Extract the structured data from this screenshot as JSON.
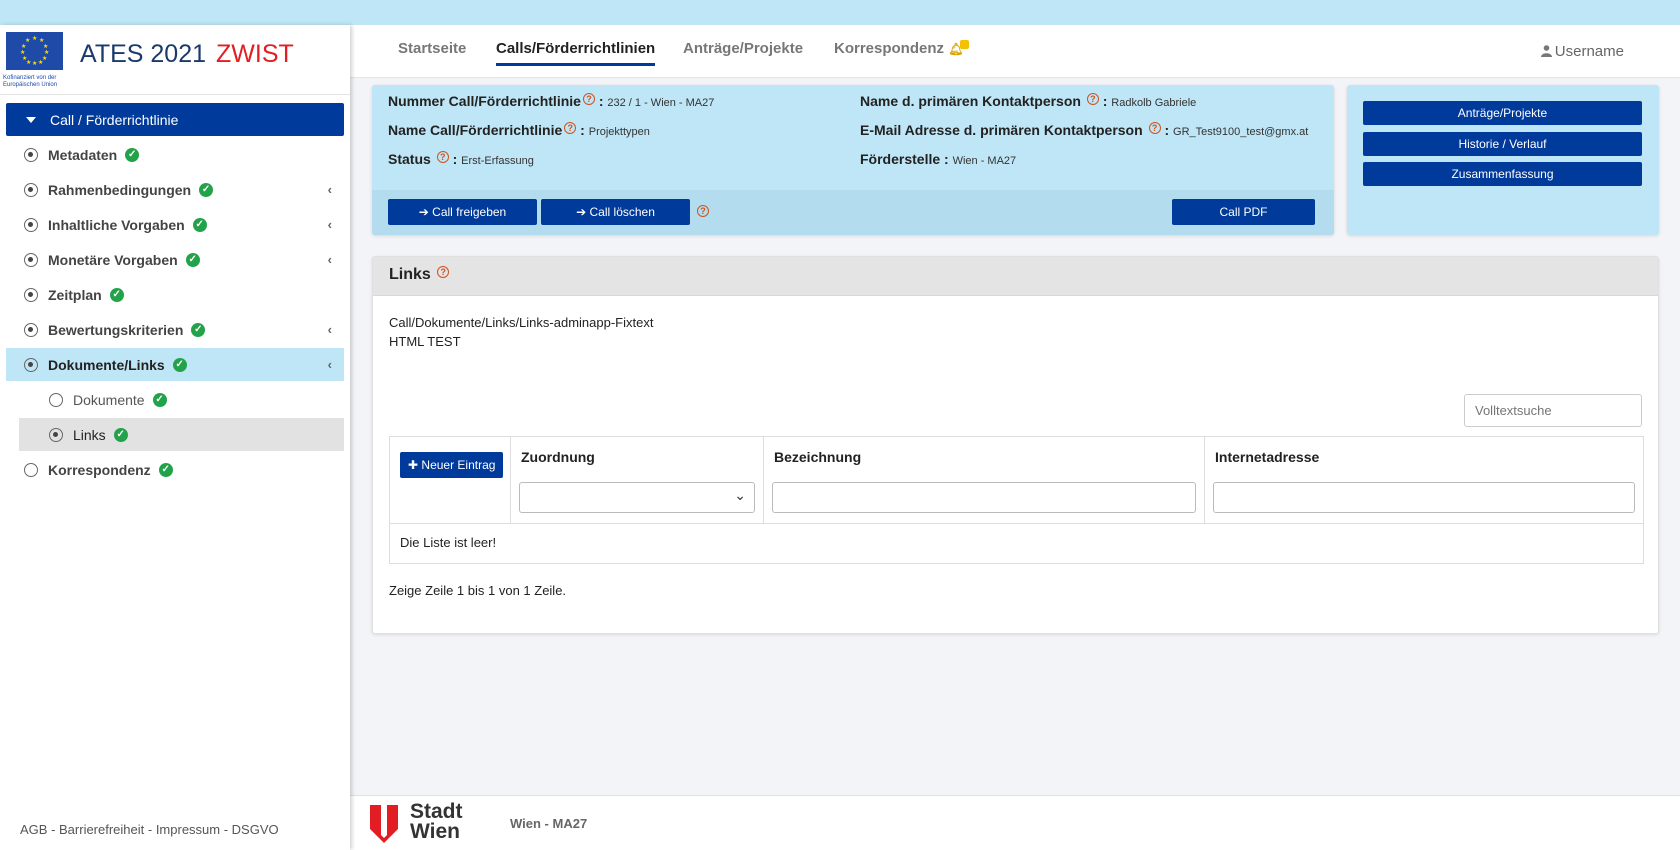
{
  "app": {
    "title": "ATES 2021",
    "env": "ZWIST",
    "eu_caption": "Kofinanziert von der Europäischen Union"
  },
  "colors": {
    "primary": "#003a9b",
    "info_bg": "#bfe6f6",
    "env_red": "#e21e24",
    "check_green": "#22a34a"
  },
  "sidebar": {
    "header": "Call / Förderrichtlinie",
    "items": [
      {
        "label": "Metadaten",
        "icon": "radio-checked-icon"
      },
      {
        "label": "Rahmenbedingungen",
        "icon": "radio-checked-icon"
      },
      {
        "label": "Inhaltliche Vorgaben",
        "icon": "radio-checked-icon"
      },
      {
        "label": "Monetäre Vorgaben",
        "icon": "radio-checked-icon"
      },
      {
        "label": "Zeitplan",
        "icon": "radio-checked-icon"
      },
      {
        "label": "Bewertungskriterien",
        "icon": "radio-checked-icon"
      },
      {
        "label": "Dokumente/Links",
        "icon": "radio-checked-icon"
      },
      {
        "label": "Dokumente",
        "icon": "radio-empty-icon"
      },
      {
        "label": "Links",
        "icon": "radio-checked-icon"
      },
      {
        "label": "Korrespondenz",
        "icon": "radio-empty-icon"
      }
    ],
    "footer": "AGB - Barrierefreiheit - Impressum - DSGVO"
  },
  "topnav": {
    "tabs": [
      "Startseite",
      "Calls/Förderrichtlinien",
      "Anträge/Projekte",
      "Korrespondenz"
    ],
    "active_tab": "Calls/Förderrichtlinien",
    "user": "Username"
  },
  "info": {
    "nummer_label": "Nummer Call/Förderrichtlinie",
    "nummer_value": "232 / 1 - Wien - MA27",
    "name_label": "Name Call/Förderrichtlinie",
    "name_value": "Projekttypen",
    "status_label": "Status",
    "status_value": "Erst-Erfassung",
    "kontakt_label": "Name d. primären Kontaktperson",
    "kontakt_value": "Radkolb Gabriele",
    "email_label": "E-Mail Adresse d. primären Kontaktperson",
    "email_value": "GR_Test9100_test@gmx.at",
    "foerderstelle_label": "Förderstelle :",
    "foerderstelle_value": "Wien - MA27",
    "btn_freigeben": "Call freigeben",
    "btn_loeschen": "Call löschen",
    "btn_pdf": "Call PDF"
  },
  "side_actions": [
    "Anträge/Projekte",
    "Historie / Verlauf",
    "Zusammenfassung"
  ],
  "links": {
    "title": "Links",
    "text_line1": "Call/Dokumente/Links/Links-adminapp-Fixtext",
    "text_line2": "HTML TEST",
    "search_placeholder": "Volltextsuche",
    "new_entry": "Neuer Eintrag",
    "columns": [
      "Zuordnung",
      "Bezeichnung",
      "Internetadresse"
    ],
    "empty": "Die Liste ist leer!",
    "rowinfo": "Zeige Zeile 1 bis 1 von 1 Zeile."
  },
  "footer": {
    "city_line1": "Stadt",
    "city_line2": "Wien",
    "dept": "Wien - MA27"
  }
}
